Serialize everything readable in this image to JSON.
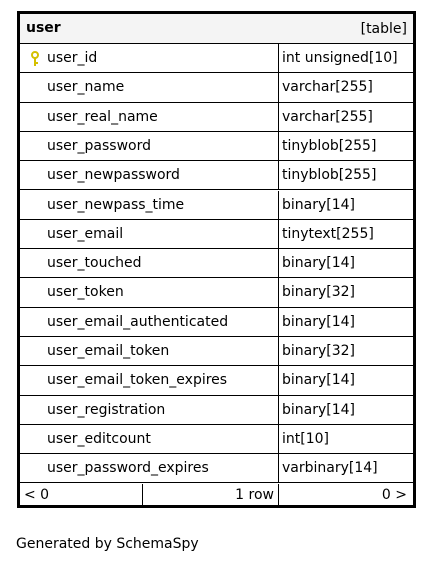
{
  "table": {
    "name": "user",
    "kind": "[table]",
    "columns": [
      {
        "name": "user_id",
        "type": "int unsigned[10]",
        "primary_key": true
      },
      {
        "name": "user_name",
        "type": "varchar[255]"
      },
      {
        "name": "user_real_name",
        "type": "varchar[255]"
      },
      {
        "name": "user_password",
        "type": "tinyblob[255]"
      },
      {
        "name": "user_newpassword",
        "type": "tinyblob[255]"
      },
      {
        "name": "user_newpass_time",
        "type": "binary[14]"
      },
      {
        "name": "user_email",
        "type": "tinytext[255]"
      },
      {
        "name": "user_touched",
        "type": "binary[14]"
      },
      {
        "name": "user_token",
        "type": "binary[32]"
      },
      {
        "name": "user_email_authenticated",
        "type": "binary[14]"
      },
      {
        "name": "user_email_token",
        "type": "binary[32]"
      },
      {
        "name": "user_email_token_expires",
        "type": "binary[14]"
      },
      {
        "name": "user_registration",
        "type": "binary[14]"
      },
      {
        "name": "user_editcount",
        "type": "int[10]"
      },
      {
        "name": "user_password_expires",
        "type": "varbinary[14]"
      }
    ],
    "footer": {
      "parents": "< 0",
      "rows": "1 row",
      "children": "0 >"
    }
  },
  "generated_by": "Generated by SchemaSpy",
  "colors": {
    "header_bg": "#f4f4f4",
    "key_icon": "#d4c000",
    "border": "#000000"
  },
  "icons": {
    "primary_key": "key-icon"
  }
}
